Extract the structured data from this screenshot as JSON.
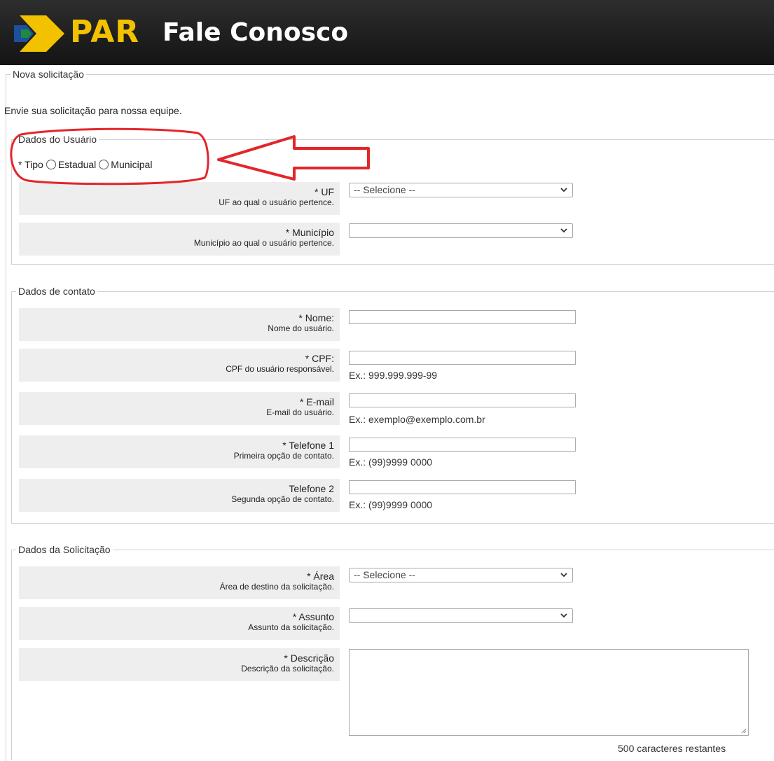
{
  "header": {
    "brand": "PAR",
    "title": "Fale Conosco"
  },
  "form": {
    "legend": "Nova solicitação",
    "intro": "Envie sua solicitação para nossa equipe."
  },
  "usuario": {
    "legend": "Dados do Usuário",
    "tipo_label": "* Tipo",
    "options": [
      "Estadual",
      "Municipal"
    ],
    "uf": {
      "label": "* UF",
      "hint": "UF ao qual o usuário pertence.",
      "value": "-- Selecione --"
    },
    "municipio": {
      "label": "* Município",
      "hint": "Município ao qual o usuário pertence.",
      "value": ""
    }
  },
  "contato": {
    "legend": "Dados de contato",
    "nome": {
      "label": "* Nome:",
      "hint": "Nome do usuário."
    },
    "cpf": {
      "label": "* CPF:",
      "hint": "CPF do usuário responsável.",
      "example": "Ex.: 999.999.999-99"
    },
    "email": {
      "label": "* E-mail",
      "hint": "E-mail do usuário.",
      "example": "Ex.: exemplo@exemplo.com.br"
    },
    "tel1": {
      "label": "* Telefone 1",
      "hint": "Primeira opção de contato.",
      "example": "Ex.: (99)9999 0000"
    },
    "tel2": {
      "label": "Telefone 2",
      "hint": "Segunda opção de contato.",
      "example": "Ex.: (99)9999 0000"
    }
  },
  "solicitacao": {
    "legend": "Dados da Solicitação",
    "area": {
      "label": "* Área",
      "hint": "Área de destino da solicitação.",
      "value": "-- Selecione --"
    },
    "assunto": {
      "label": "* Assunto",
      "hint": "Assunto da solicitação.",
      "value": ""
    },
    "descricao": {
      "label": "* Descrição",
      "hint": "Descrição da solicitação."
    },
    "counter": "500 caracteres restantes"
  },
  "colors": {
    "header_bg": "#1f1f1f",
    "brand_yellow": "#f2c200",
    "brand_green": "#1f8a3c",
    "brand_blue": "#1c4fa0",
    "annotation_red": "#e3262a",
    "label_bg": "#eeeeee"
  },
  "icons": {
    "logo": "par-logo-icon",
    "select": "chevron-down-icon",
    "annotation": "red-arrow-icon"
  }
}
